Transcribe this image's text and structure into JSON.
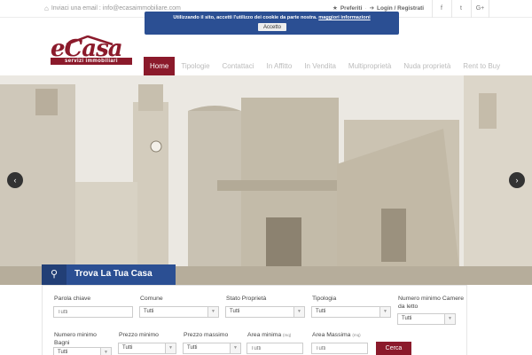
{
  "topbar": {
    "email_text": "Inviaci una email : info@ecasaimmobiliare.com",
    "favorites": "Preferiti",
    "login": "Login / Registrati",
    "social": [
      {
        "icon": "facebook-icon",
        "glyph": "f"
      },
      {
        "icon": "twitter-icon",
        "glyph": "t"
      },
      {
        "icon": "google-plus-icon",
        "glyph": "G+"
      }
    ]
  },
  "cookie": {
    "message": "Utilizzando il sito, accetti l'utilizzo dei cookie da parte nostra.",
    "link": "maggiori informazioni",
    "accept": "Accetto"
  },
  "logo": {
    "word": "eCasa",
    "tagline": "servizi immobiliari"
  },
  "nav": {
    "items": [
      "Home",
      "Tipologie",
      "Contattaci",
      "In Affitto",
      "In Vendita",
      "Multiproprietà",
      "Nuda proprietà",
      "Rent to Buy"
    ],
    "active": "Home"
  },
  "hero": {
    "prev": "‹",
    "next": "›"
  },
  "search": {
    "title": "Trova La Tua Casa",
    "labels": {
      "keyword": "Parola chiave",
      "comune": "Comune",
      "stato": "Stato Proprietà",
      "tipologia": "Tipologia",
      "camere": "Numero minimo Camere da letto",
      "bagni": "Numero minimo Bagni",
      "prezzo_min": "Prezzo minimo",
      "prezzo_max": "Prezzo massimo",
      "area_min": "Area minima",
      "area_max": "Area Massima",
      "unit": "(mq)"
    },
    "placeholder": "Tutti",
    "select_value": "Tutti",
    "submit": "Cerca"
  },
  "colors": {
    "brand": "#8b1a2b",
    "blue": "#2b4f93"
  }
}
